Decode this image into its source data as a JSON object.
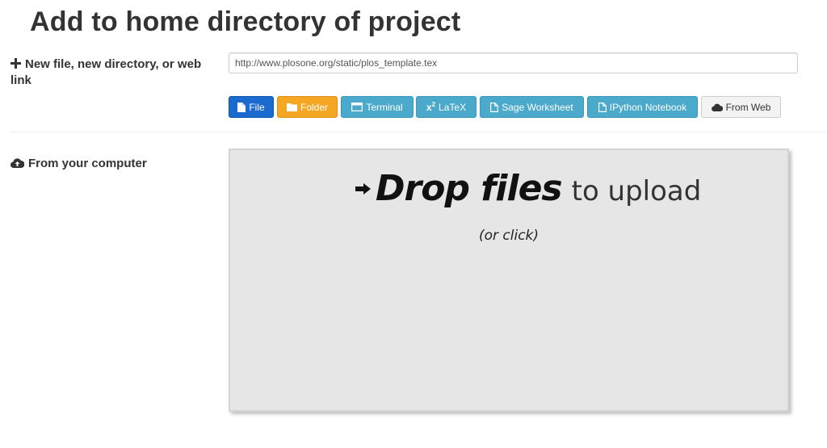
{
  "page_title": "Add to home directory of project",
  "new_item": {
    "label": "New file, new directory, or web link",
    "input_value": "http://www.plosone.org/static/plos_template.tex",
    "buttons": [
      {
        "label": "File",
        "icon": "file-icon",
        "color": "#1b6ad0"
      },
      {
        "label": "Folder",
        "icon": "folder-icon",
        "color": "#f5a623"
      },
      {
        "label": "Terminal",
        "icon": "terminal-icon",
        "color": "#4ba9cc"
      },
      {
        "label": "LaTeX",
        "icon": "superscript-icon",
        "color": "#4ba9cc"
      },
      {
        "label": "Sage Worksheet",
        "icon": "file-icon",
        "color": "#4ba9cc"
      },
      {
        "label": "IPython Notebook",
        "icon": "file-icon",
        "color": "#4ba9cc"
      },
      {
        "label": "From Web",
        "icon": "cloud-icon",
        "color": "#f3f3f3"
      }
    ]
  },
  "upload": {
    "label": "From your computer",
    "drop_strong": "Drop files",
    "drop_light": "to upload",
    "drop_sub": "(or click)"
  }
}
